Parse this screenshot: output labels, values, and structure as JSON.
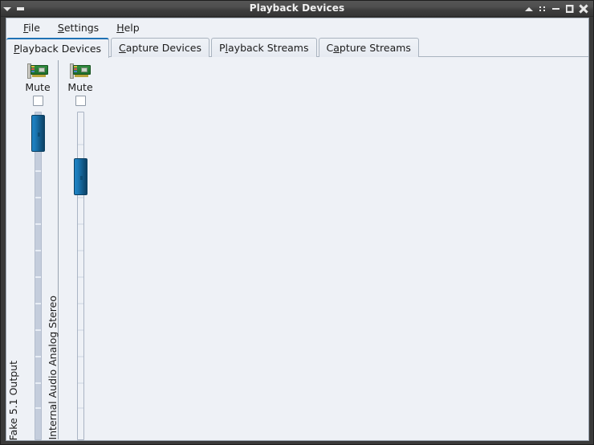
{
  "window": {
    "title": "Playback Devices",
    "left_icons": [
      {
        "name": "window-menu-triangle-icon",
        "glyph": "triangle-down"
      },
      {
        "name": "window-shade-bar-icon",
        "glyph": "bar"
      }
    ],
    "controls": [
      {
        "name": "shade-button",
        "glyph": "triangle-up",
        "tooltip": "Shade"
      },
      {
        "name": "sticky-button",
        "glyph": "dots",
        "tooltip": "Sticky"
      },
      {
        "name": "minimize-button",
        "glyph": "minimize",
        "tooltip": "Minimize"
      },
      {
        "name": "maximize-button",
        "glyph": "restore",
        "tooltip": "Maximize"
      },
      {
        "name": "close-button",
        "glyph": "close",
        "tooltip": "Close"
      }
    ]
  },
  "menubar": {
    "items": [
      {
        "label": "File",
        "mnemonic": "F",
        "rest": "ile"
      },
      {
        "label": "Settings",
        "mnemonic": "S",
        "rest": "ettings"
      },
      {
        "label": "Help",
        "mnemonic": "H",
        "rest": "elp"
      }
    ]
  },
  "tabs": [
    {
      "label": "Playback Devices",
      "pre": "",
      "mnemonic": "P",
      "rest": "layback Devices",
      "active": true
    },
    {
      "label": "Capture Devices",
      "pre": "",
      "mnemonic": "C",
      "rest": "apture Devices",
      "active": false
    },
    {
      "label": "Playback Streams",
      "pre": "P",
      "mnemonic": "l",
      "rest": "ayback Streams",
      "active": false
    },
    {
      "label": "Capture Streams",
      "pre": "C",
      "mnemonic": "a",
      "rest": "pture Streams",
      "active": false
    }
  ],
  "devices": [
    {
      "name": "Fake 5.1 Output",
      "icon": "sound-card-icon",
      "mute_label": "Mute",
      "muted": false,
      "volume_percent": 97,
      "track_filled": true
    },
    {
      "name": "Internal Audio Analog Stereo",
      "icon": "sound-card-icon",
      "mute_label": "Mute",
      "muted": false,
      "volume_percent": 82,
      "track_filled": false
    }
  ],
  "colors": {
    "accent": "#1f72b5",
    "panel_bg": "#eef1f6",
    "titlebar_bg": "#4a4a4a",
    "slider_thumb": "#1b7ab8",
    "track_filled": "#c4cddc",
    "border": "#a9b3bf"
  }
}
